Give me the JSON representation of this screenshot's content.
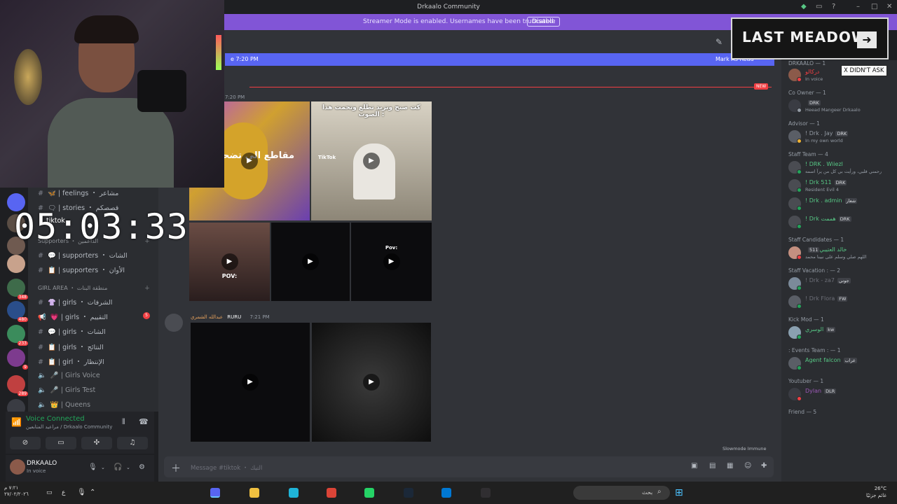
{
  "window": {
    "title": "Drkaalo Community"
  },
  "banner": {
    "message": "Streamer Mode is enabled. Usernames have been truncated.",
    "disable_label": "Disable"
  },
  "timer": "05:03:33",
  "channels": [
    {
      "emoji": "🦋",
      "name": "| feelings ・ مشاعر"
    },
    {
      "emoji": "🗨",
      "name": "| stories ・ قصصكم"
    },
    {
      "emoji": "",
      "name": "tiktok"
    }
  ],
  "supporters_category": "Supporters ・ الداعمين",
  "supporter_channels": [
    {
      "emoji": "💬",
      "name": "| supporters ・ الشات"
    },
    {
      "emoji": "📋",
      "name": "| supporters ・ الأوان"
    }
  ],
  "girl_category": "GIRL AREA ・ منطقة البنات",
  "girl_channels": [
    {
      "emoji": "👚",
      "name": "| girls ・ الشرفات"
    },
    {
      "emoji": "💗",
      "name": "| girls ・ التقييم",
      "badge": "5"
    },
    {
      "emoji": "💬",
      "name": "| girls ・ الشات"
    },
    {
      "emoji": "📋",
      "name": "| girls ・ النتائج"
    },
    {
      "emoji": "📋",
      "name": "| girl ・ الإنتظار"
    },
    {
      "emoji": "🎤",
      "name": "| Girls Voice"
    },
    {
      "emoji": "🎤",
      "name": "| Girls Test"
    },
    {
      "emoji": "👑",
      "name": "| Queens"
    }
  ],
  "server_badges": [
    "348",
    "480",
    "233",
    "9",
    "289"
  ],
  "voice": {
    "status": "Voice Connected",
    "location": "مراعيد المتابعين / Drkaalo Community"
  },
  "user": {
    "name": "DRKAALO",
    "status": "In voice"
  },
  "chat": {
    "jump_left": "e 7:20 PM",
    "jump_right": "Mark As Read",
    "new_tag": "NEW",
    "first_time": "7:20 PM",
    "video_captions": [
      "مقاطع الي تضحكني",
      "كت صبح ونزيد تطلع وتحمت هذا الصوت :",
      "POV:",
      "Pov:"
    ],
    "tiktok_label": "TikTok",
    "author_name": "عبدالله الشمري",
    "author_tag": "RURU",
    "author_time": "7:21 PM",
    "slowmode": "Slowmode Immune",
    "input_placeholder": "Message #tiktok ・ التيك"
  },
  "members": [
    {
      "type": "group",
      "label": "DRKAALO — 1"
    },
    {
      "type": "member",
      "name": "دركالو",
      "status": "In voice",
      "color": "#f23f43",
      "avatar": "#8b5a4a",
      "dot": "#f23f43"
    },
    {
      "type": "group",
      "label": "Co Owner — 1"
    },
    {
      "type": "member",
      "name": "",
      "tag": "DRK",
      "status": "Heead Mangeer Drkaalo",
      "color": "#f23f43",
      "avatar": "#3a3c43",
      "dot": "#949ba4"
    },
    {
      "type": "group",
      "label": "Advisor — 1"
    },
    {
      "type": "member",
      "name": "! Drk . Jay",
      "tag": "DRK",
      "status": "In my own world",
      "color": "#949ba4",
      "avatar": "#5a5e66",
      "dot": "#f0b232"
    },
    {
      "type": "group",
      "label": "Staff Team — 4"
    },
    {
      "type": "member",
      "name": "! DRK . Wiiezl",
      "status": "رحمني قلبي، ورأيت بي كل من يرآ اسمه",
      "color": "#57c785",
      "avatar": "#4a4c52",
      "dot": "#23a55a"
    },
    {
      "type": "member",
      "name": "! Drk 511",
      "tag": "DRK",
      "status": "Resident Evil 4",
      "color": "#57c785",
      "avatar": "#4a4c52",
      "dot": "#23a55a"
    },
    {
      "type": "member",
      "name": "! Drk . admin",
      "tag": "شعار",
      "status": "",
      "color": "#57c785",
      "avatar": "#4a4c52",
      "dot": "#23a55a"
    },
    {
      "type": "member",
      "name": "! Drk هممت",
      "tag": "DRK",
      "status": "",
      "color": "#57c785",
      "avatar": "#4a4c52",
      "dot": "#23a55a"
    },
    {
      "type": "group",
      "label": "Staff Candidates — 1"
    },
    {
      "type": "member",
      "name": "خالد العتيبي",
      "tag": "511",
      "status": "اللهم صلي وسلم على نبينا محمد",
      "color": "#57c785",
      "avatar": "#c49080",
      "dot": "#f23f43"
    },
    {
      "type": "group",
      "label": "Staff Vacation : — 2"
    },
    {
      "type": "member",
      "name": "! Drk - za7",
      "tag": "جوني",
      "status": "",
      "color": "#6d6f78",
      "avatar": "#7b8a9a",
      "dot": "#23a55a"
    },
    {
      "type": "member",
      "name": "! Drk Flora",
      "tag": "FW",
      "status": "",
      "color": "#6d6f78",
      "avatar": "#5a5e66",
      "dot": "#23a55a"
    },
    {
      "type": "group",
      "label": "Kick Mod — 1"
    },
    {
      "type": "member",
      "name": "الوسري",
      "tag": "kw",
      "status": "",
      "color": "#57c785",
      "avatar": "#8aa0b0",
      "dot": "#23a55a"
    },
    {
      "type": "group",
      "label": ": Events Team : — 1"
    },
    {
      "type": "member",
      "name": "Agent falcon",
      "tag": "عراب",
      "status": "",
      "color": "#57c785",
      "avatar": "#5a5e66",
      "dot": "#23a55a"
    },
    {
      "type": "group",
      "label": "Youtuber — 1"
    },
    {
      "type": "member",
      "name": "Dylan",
      "tag": "DLR",
      "status": "",
      "color": "#9b59b6",
      "avatar": "#3a3c43",
      "dot": "#f23f43"
    },
    {
      "type": "group",
      "label": "Friend — 5"
    }
  ],
  "overlay": {
    "ad_title": "LAST MEADOW",
    "ad_arrow": "➜",
    "x_didnt_ask": "X DIDN'T ASK"
  },
  "taskbar": {
    "time": "٧:٢١ م",
    "date": "٢٧/٠٢/٢٠٢٦",
    "search_label": "بحث",
    "weather_temp": "26°C",
    "weather_text": "غائم جزئيًا",
    "icons": [
      {
        "name": "discord-icon",
        "color": "#5865f2"
      },
      {
        "name": "explorer-icon",
        "color": "#f0c040"
      },
      {
        "name": "edge-icon",
        "color": "#1fb4d8"
      },
      {
        "name": "chrome-icon",
        "color": "#db4437"
      },
      {
        "name": "whatsapp-icon",
        "color": "#25d366"
      },
      {
        "name": "steam-icon",
        "color": "#1b2838"
      },
      {
        "name": "store-icon",
        "color": "#0078d4"
      },
      {
        "name": "obs-icon",
        "color": "#302e31"
      }
    ]
  }
}
